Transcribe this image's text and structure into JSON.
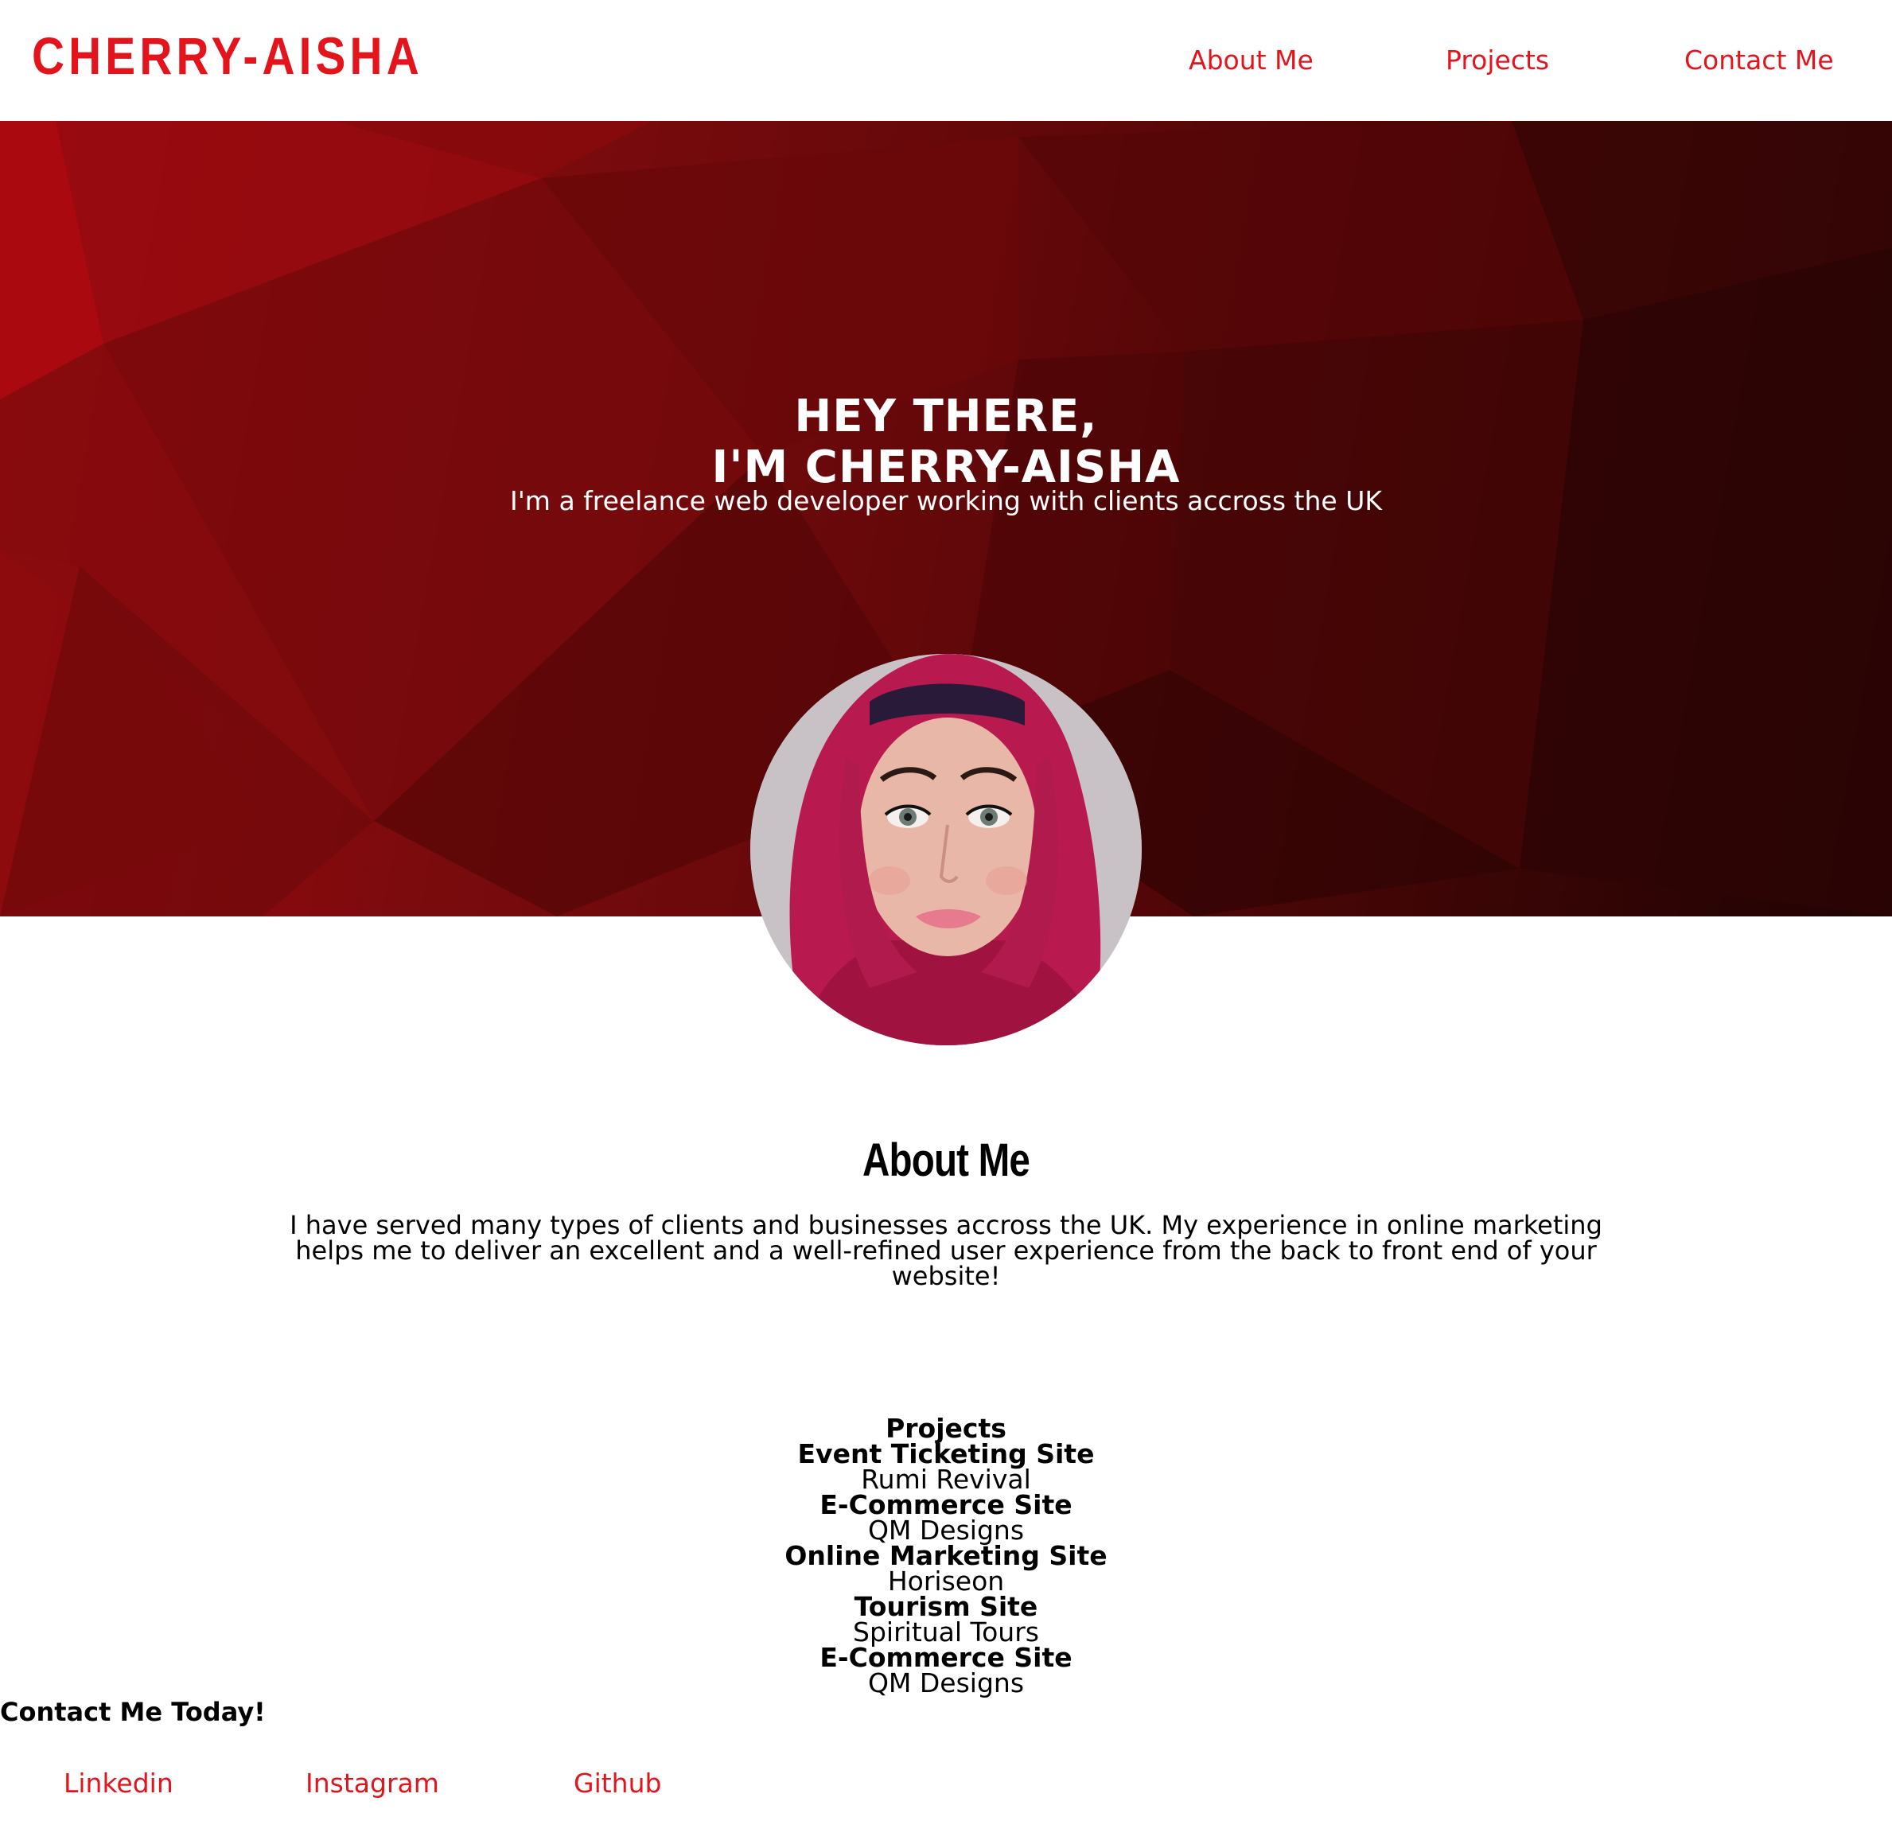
{
  "header": {
    "logo": "CHERRY-AISHA",
    "nav": [
      {
        "label": "About Me"
      },
      {
        "label": "Projects"
      },
      {
        "label": "Contact Me"
      }
    ]
  },
  "hero": {
    "title_line1": "HEY THERE,",
    "title_line2": "I'M CHERRY-AISHA",
    "subtitle": "I'm a freelance web developer working with clients accross the UK"
  },
  "about": {
    "heading": "About Me",
    "text": "I have served many types of clients and businesses accross the UK. My experience in online marketing helps me to deliver an excellent and a well-refined user experience from the back to front end of your website!"
  },
  "projects": {
    "heading": "Projects",
    "items": [
      {
        "type": "Event Ticketing Site",
        "name": "Rumi Revival"
      },
      {
        "type": "E-Commerce Site",
        "name": "QM Designs"
      },
      {
        "type": "Online Marketing Site",
        "name": "Horiseon"
      },
      {
        "type": "Tourism Site",
        "name": "Spiritual Tours"
      },
      {
        "type": "E-Commerce Site",
        "name": "QM Designs"
      }
    ]
  },
  "contact": {
    "heading": "Contact Me Today!",
    "links": [
      {
        "label": "Linkedin"
      },
      {
        "label": "Instagram"
      },
      {
        "label": "Github"
      }
    ]
  },
  "colors": {
    "accent": "#e3141c",
    "hero_dark": "#3d0505",
    "hero_light": "#a3080e",
    "text": "#000000",
    "background": "#ffffff"
  },
  "icons": {
    "avatar": "profile-photo"
  }
}
